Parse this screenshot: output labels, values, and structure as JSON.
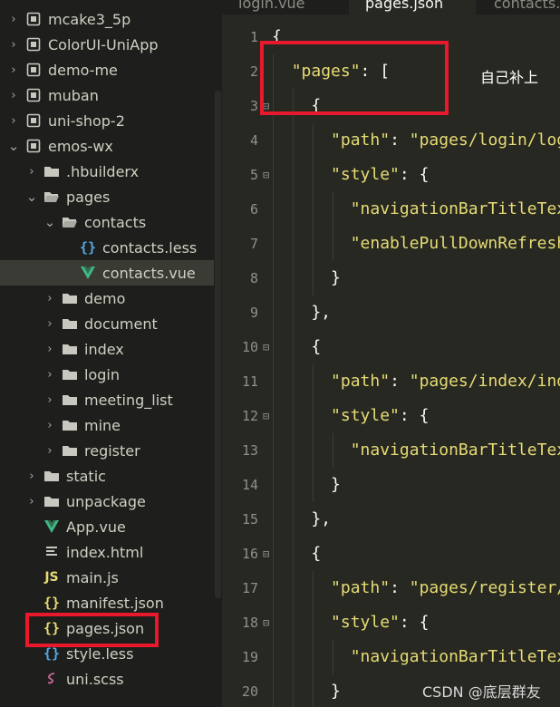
{
  "explorer": {
    "items": [
      {
        "label": "mcake3_5p",
        "icon": "project-icon",
        "chevron": "right"
      },
      {
        "label": "ColorUI-UniApp",
        "icon": "project-icon",
        "chevron": "right"
      },
      {
        "label": "demo-me",
        "icon": "project-icon",
        "chevron": "right"
      },
      {
        "label": "muban",
        "icon": "project-icon",
        "chevron": "right"
      },
      {
        "label": "uni-shop-2",
        "icon": "project-icon",
        "chevron": "right"
      },
      {
        "label": "emos-wx",
        "icon": "project-icon",
        "chevron": "down"
      },
      {
        "label": ".hbuilderx",
        "icon": "folder-icon",
        "chevron": "right"
      },
      {
        "label": "pages",
        "icon": "folder-open-icon",
        "chevron": "down"
      },
      {
        "label": "contacts",
        "icon": "folder-open-icon",
        "chevron": "down"
      },
      {
        "label": "contacts.less",
        "icon": "less-file-icon",
        "chevron": "none"
      },
      {
        "label": "contacts.vue",
        "icon": "vue-file-icon",
        "chevron": "none",
        "selected": true
      },
      {
        "label": "demo",
        "icon": "folder-icon",
        "chevron": "right"
      },
      {
        "label": "document",
        "icon": "folder-icon",
        "chevron": "right"
      },
      {
        "label": "index",
        "icon": "folder-icon",
        "chevron": "right"
      },
      {
        "label": "login",
        "icon": "folder-icon",
        "chevron": "right"
      },
      {
        "label": "meeting_list",
        "icon": "folder-icon",
        "chevron": "right"
      },
      {
        "label": "mine",
        "icon": "folder-icon",
        "chevron": "right"
      },
      {
        "label": "register",
        "icon": "folder-icon",
        "chevron": "right"
      },
      {
        "label": "static",
        "icon": "folder-icon",
        "chevron": "right"
      },
      {
        "label": "unpackage",
        "icon": "folder-icon",
        "chevron": "right"
      },
      {
        "label": "App.vue",
        "icon": "vue-file-icon",
        "chevron": "none"
      },
      {
        "label": "index.html",
        "icon": "html-file-icon",
        "chevron": "none"
      },
      {
        "label": "main.js",
        "icon": "js-file-icon",
        "chevron": "none"
      },
      {
        "label": "manifest.json",
        "icon": "json-file-icon",
        "chevron": "none"
      },
      {
        "label": "pages.json",
        "icon": "json-file-icon",
        "chevron": "none"
      },
      {
        "label": "style.less",
        "icon": "less-file-icon",
        "chevron": "none"
      },
      {
        "label": "uni.scss",
        "icon": "scss-file-icon",
        "chevron": "none"
      }
    ]
  },
  "tabs": [
    {
      "label": "login.vue"
    },
    {
      "label": "pages.json",
      "active": true
    },
    {
      "label": "contacts.vue"
    }
  ],
  "code_lines": [
    {
      "n": "1",
      "fold": false,
      "tokens": [
        [
          "p",
          "{"
        ]
      ]
    },
    {
      "n": "2",
      "fold": false,
      "tokens": [
        [
          "i",
          "  "
        ],
        [
          "s",
          "\"pages\""
        ],
        [
          "p",
          ": ["
        ]
      ]
    },
    {
      "n": "3",
      "fold": true,
      "tokens": [
        [
          "i",
          "    "
        ],
        [
          "p",
          "{"
        ]
      ]
    },
    {
      "n": "4",
      "fold": false,
      "tokens": [
        [
          "i",
          "      "
        ],
        [
          "s",
          "\"path\""
        ],
        [
          "p",
          ": "
        ],
        [
          "s",
          "\"pages/login/login\""
        ],
        [
          "p",
          ","
        ]
      ]
    },
    {
      "n": "5",
      "fold": true,
      "tokens": [
        [
          "i",
          "      "
        ],
        [
          "s",
          "\"style\""
        ],
        [
          "p",
          ": {"
        ]
      ]
    },
    {
      "n": "6",
      "fold": false,
      "tokens": [
        [
          "i",
          "        "
        ],
        [
          "s",
          "\"navigationBarTitleText\""
        ],
        [
          "p",
          ": "
        ],
        [
          "s",
          "\"\""
        ]
      ]
    },
    {
      "n": "7",
      "fold": false,
      "tokens": [
        [
          "i",
          "        "
        ],
        [
          "s",
          "\"enablePullDownRefresh\""
        ],
        [
          "p",
          ": "
        ],
        [
          "k",
          "false"
        ]
      ]
    },
    {
      "n": "8",
      "fold": false,
      "tokens": [
        [
          "i",
          "      "
        ],
        [
          "p",
          "}"
        ]
      ]
    },
    {
      "n": "9",
      "fold": false,
      "tokens": [
        [
          "i",
          "    "
        ],
        [
          "p",
          "},"
        ]
      ]
    },
    {
      "n": "10",
      "fold": true,
      "tokens": [
        [
          "i",
          "    "
        ],
        [
          "p",
          "{"
        ]
      ]
    },
    {
      "n": "11",
      "fold": false,
      "tokens": [
        [
          "i",
          "      "
        ],
        [
          "s",
          "\"path\""
        ],
        [
          "p",
          ": "
        ],
        [
          "s",
          "\"pages/index/index\""
        ],
        [
          "p",
          ","
        ]
      ]
    },
    {
      "n": "12",
      "fold": true,
      "tokens": [
        [
          "i",
          "      "
        ],
        [
          "s",
          "\"style\""
        ],
        [
          "p",
          ": {"
        ]
      ]
    },
    {
      "n": "13",
      "fold": false,
      "tokens": [
        [
          "i",
          "        "
        ],
        [
          "s",
          "\"navigationBarTitleText\""
        ],
        [
          "p",
          ": "
        ],
        [
          "s",
          "\"\""
        ]
      ]
    },
    {
      "n": "14",
      "fold": false,
      "tokens": [
        [
          "i",
          "      "
        ],
        [
          "p",
          "}"
        ]
      ]
    },
    {
      "n": "15",
      "fold": false,
      "tokens": [
        [
          "i",
          "    "
        ],
        [
          "p",
          "},"
        ]
      ]
    },
    {
      "n": "16",
      "fold": true,
      "tokens": [
        [
          "i",
          "    "
        ],
        [
          "p",
          "{"
        ]
      ]
    },
    {
      "n": "17",
      "fold": false,
      "tokens": [
        [
          "i",
          "      "
        ],
        [
          "s",
          "\"path\""
        ],
        [
          "p",
          ": "
        ],
        [
          "s",
          "\"pages/register/register\""
        ],
        [
          "p",
          ","
        ]
      ]
    },
    {
      "n": "18",
      "fold": true,
      "tokens": [
        [
          "i",
          "      "
        ],
        [
          "s",
          "\"style\""
        ],
        [
          "p",
          ": {"
        ]
      ]
    },
    {
      "n": "19",
      "fold": false,
      "tokens": [
        [
          "i",
          "        "
        ],
        [
          "s",
          "\"navigationBarTitleText\""
        ],
        [
          "p",
          ": "
        ],
        [
          "s",
          "\"\""
        ]
      ]
    },
    {
      "n": "20",
      "fold": false,
      "tokens": [
        [
          "i",
          "      "
        ],
        [
          "p",
          "}"
        ]
      ]
    }
  ],
  "annotation": "自己补上",
  "watermark": "CSDN @底层群友",
  "colors": {
    "highlight_box": "#e8192c",
    "editor_bg": "#272822",
    "sidebar_bg": "#1e1f1c",
    "string": "#e6db74",
    "keyword": "#66d9ef"
  }
}
